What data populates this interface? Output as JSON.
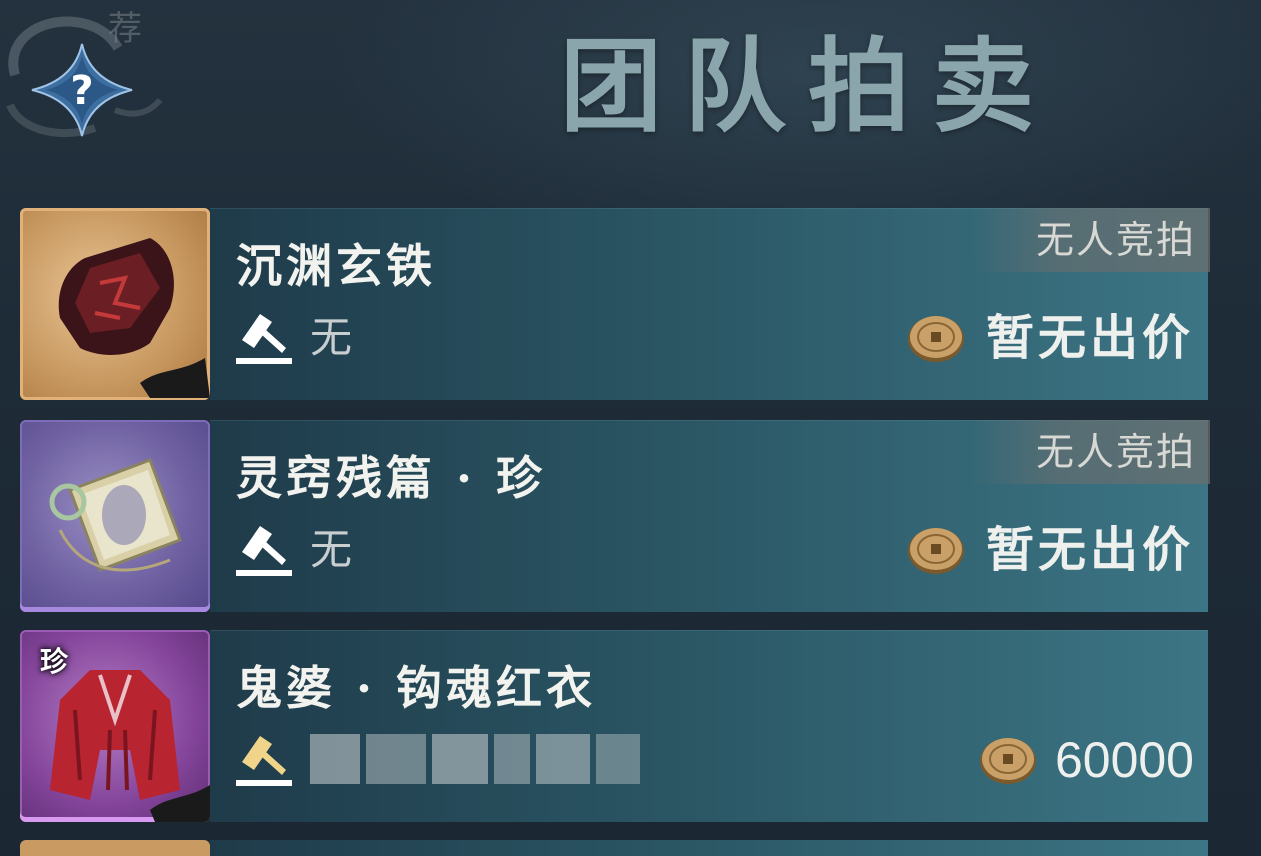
{
  "header": {
    "title": "团队拍卖",
    "recommend_badge": "荐",
    "help_icon": "question-mark-diamond-icon"
  },
  "items": [
    {
      "name": "沉渊玄铁",
      "bidder": "无",
      "status": "无人竞拍",
      "price": "暂无出价",
      "rarity_color": "#e0b27a",
      "item_icon": "dark-red-ore-icon"
    },
    {
      "name": "灵窍残篇 · 珍",
      "bidder": "无",
      "status": "无人竞拍",
      "price": "暂无出价",
      "rarity_color": "#a889e0",
      "item_icon": "scroll-book-icon"
    },
    {
      "name": "鬼婆 · 钩魂红衣",
      "bidder_blurred": true,
      "rare_tag": "珍",
      "price": "60000",
      "rarity_color": "#d79af0",
      "item_icon": "red-robe-icon"
    }
  ],
  "colors": {
    "title": "#8aa6ac",
    "row_gradient_start": "#1f3b4a",
    "row_gradient_end": "#3c7585",
    "bidder_icon_active": "#f0d48a",
    "bidder_icon_inactive": "#ffffff"
  },
  "icons": {
    "bidder": "gavel-hammer-icon",
    "currency": "bronze-coin-icon"
  }
}
